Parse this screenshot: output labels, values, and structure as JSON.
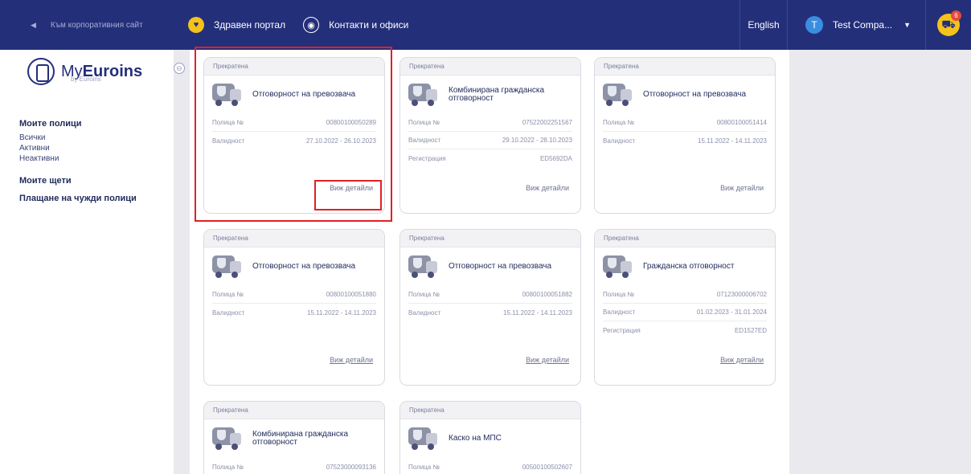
{
  "topbar": {
    "corporate_link": "Към корпоративния сайт",
    "health_portal": "Здравен портал",
    "contacts": "Контакти и офиси",
    "language": "English",
    "user_initial": "T",
    "user_name": "Test Compa...",
    "cart_count": "6"
  },
  "sidebar": {
    "logo_main": "My",
    "logo_bold": "Euroins",
    "logo_sub": "by Euroins",
    "my_policies": "Моите полици",
    "all": "Всички",
    "active": "Активни",
    "inactive": "Неактивни",
    "my_claims": "Моите щети",
    "pay_others": "Плащане на чужди полици"
  },
  "cards": [
    {
      "status": "Прекратена",
      "title": "Отговорност на превозвача",
      "labels": [
        "Полица №",
        "Валидност"
      ],
      "values": [
        "00800100050289",
        "27.10.2022 - 26.10.2023"
      ],
      "link": "Виж детайли"
    },
    {
      "status": "Прекратена",
      "title": "Комбинирана гражданска отговорност",
      "labels": [
        "Полица №",
        "Валидност",
        "Регистрация"
      ],
      "values": [
        "07522002251567",
        "29.10.2022 - 28.10.2023",
        "ЕD5692DА"
      ],
      "link": "Виж детайли"
    },
    {
      "status": "Прекратена",
      "title": "Отговорност на превозвача",
      "labels": [
        "Полица №",
        "Валидност"
      ],
      "values": [
        "00800100051414",
        "15.11.2022 - 14.11.2023"
      ],
      "link": "Виж детайли"
    },
    {
      "status": "Прекратена",
      "title": "Отговорност на превозвача",
      "labels": [
        "Полица №",
        "Валидност"
      ],
      "values": [
        "00800100051880",
        "15.11.2022 - 14.11.2023"
      ],
      "link": "Виж детайли"
    },
    {
      "status": "Прекратена",
      "title": "Отговорност на превозвача",
      "labels": [
        "Полица №",
        "Валидност"
      ],
      "values": [
        "00800100051882",
        "15.11.2022 - 14.11.2023"
      ],
      "link": "Виж детайли"
    },
    {
      "status": "Прекратена",
      "title": "Гражданска отговорност",
      "labels": [
        "Полица №",
        "Валидност",
        "Регистрация"
      ],
      "values": [
        "07123000006702",
        "01.02.2023 - 31.01.2024",
        "ЕD1527ЕD"
      ],
      "link": "Виж детайли"
    },
    {
      "status": "Прекратена",
      "title": "Комбинирана гражданска отговорност",
      "labels": [
        "Полица №"
      ],
      "values": [
        "07523000093136"
      ],
      "link": ""
    },
    {
      "status": "Прекратена",
      "title": "Каско на МПС",
      "labels": [
        "Полица №"
      ],
      "values": [
        "00500100502607"
      ],
      "link": ""
    }
  ],
  "colors": {
    "brand": "#242f7a",
    "accent": "#f3c21b",
    "highlight": "#e21f26"
  }
}
